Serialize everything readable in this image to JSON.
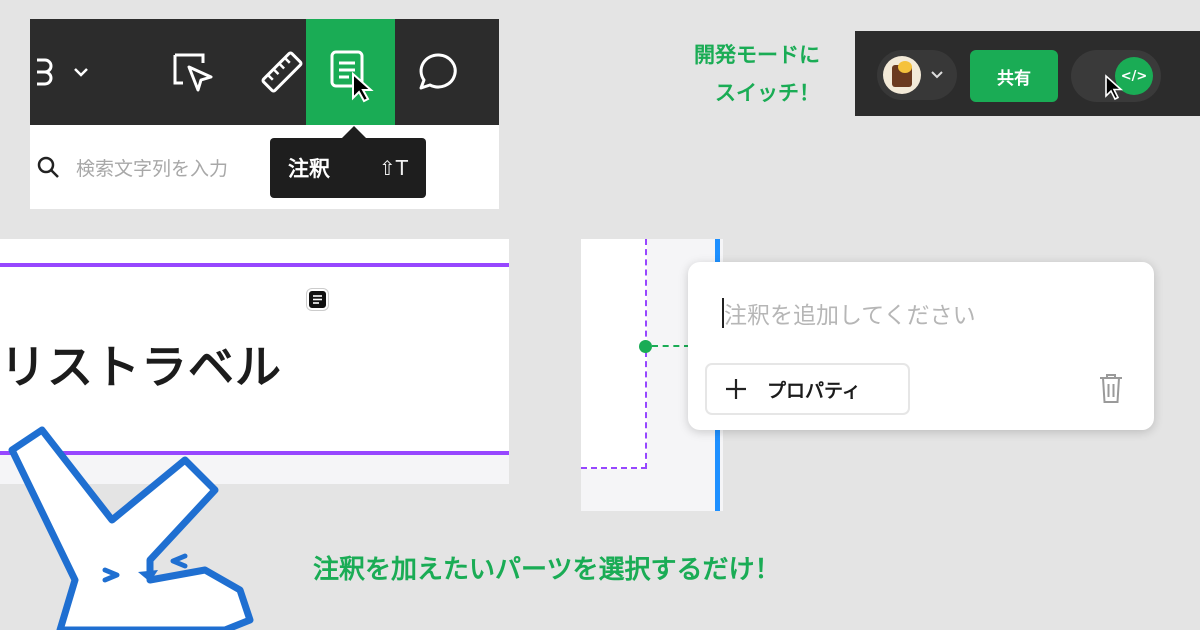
{
  "toolbar": {
    "tools": [
      {
        "name": "main-menu",
        "icon": "figma-logo-icon"
      },
      {
        "name": "move",
        "icon": "cursor-arrow-icon"
      },
      {
        "name": "measure",
        "icon": "ruler-icon"
      },
      {
        "name": "annotate",
        "icon": "annotation-note-icon",
        "active": true
      },
      {
        "name": "comment",
        "icon": "speech-bubble-icon"
      }
    ],
    "search_placeholder": "検索文字列を入力",
    "tooltip": {
      "label": "注釈",
      "shortcut": "⇧T"
    },
    "accent": "#1aac55",
    "bg": "#2c2c2c"
  },
  "devmode": {
    "caption_line1": "開発モードに",
    "caption_line2": "スイッチ！",
    "share_label": "共有",
    "toggle_symbol": "</>"
  },
  "canvas": {
    "frame_text": "リストラベル",
    "frame_color": "#9747ff"
  },
  "annotation": {
    "placeholder": "注釈を追加してください",
    "property_button": "プロパティ",
    "connector_color": "#1aac55",
    "selection_color": "#1e90ff"
  },
  "caption": {
    "bottom": "注釈を加えたいパーツを選択するだけ！"
  }
}
